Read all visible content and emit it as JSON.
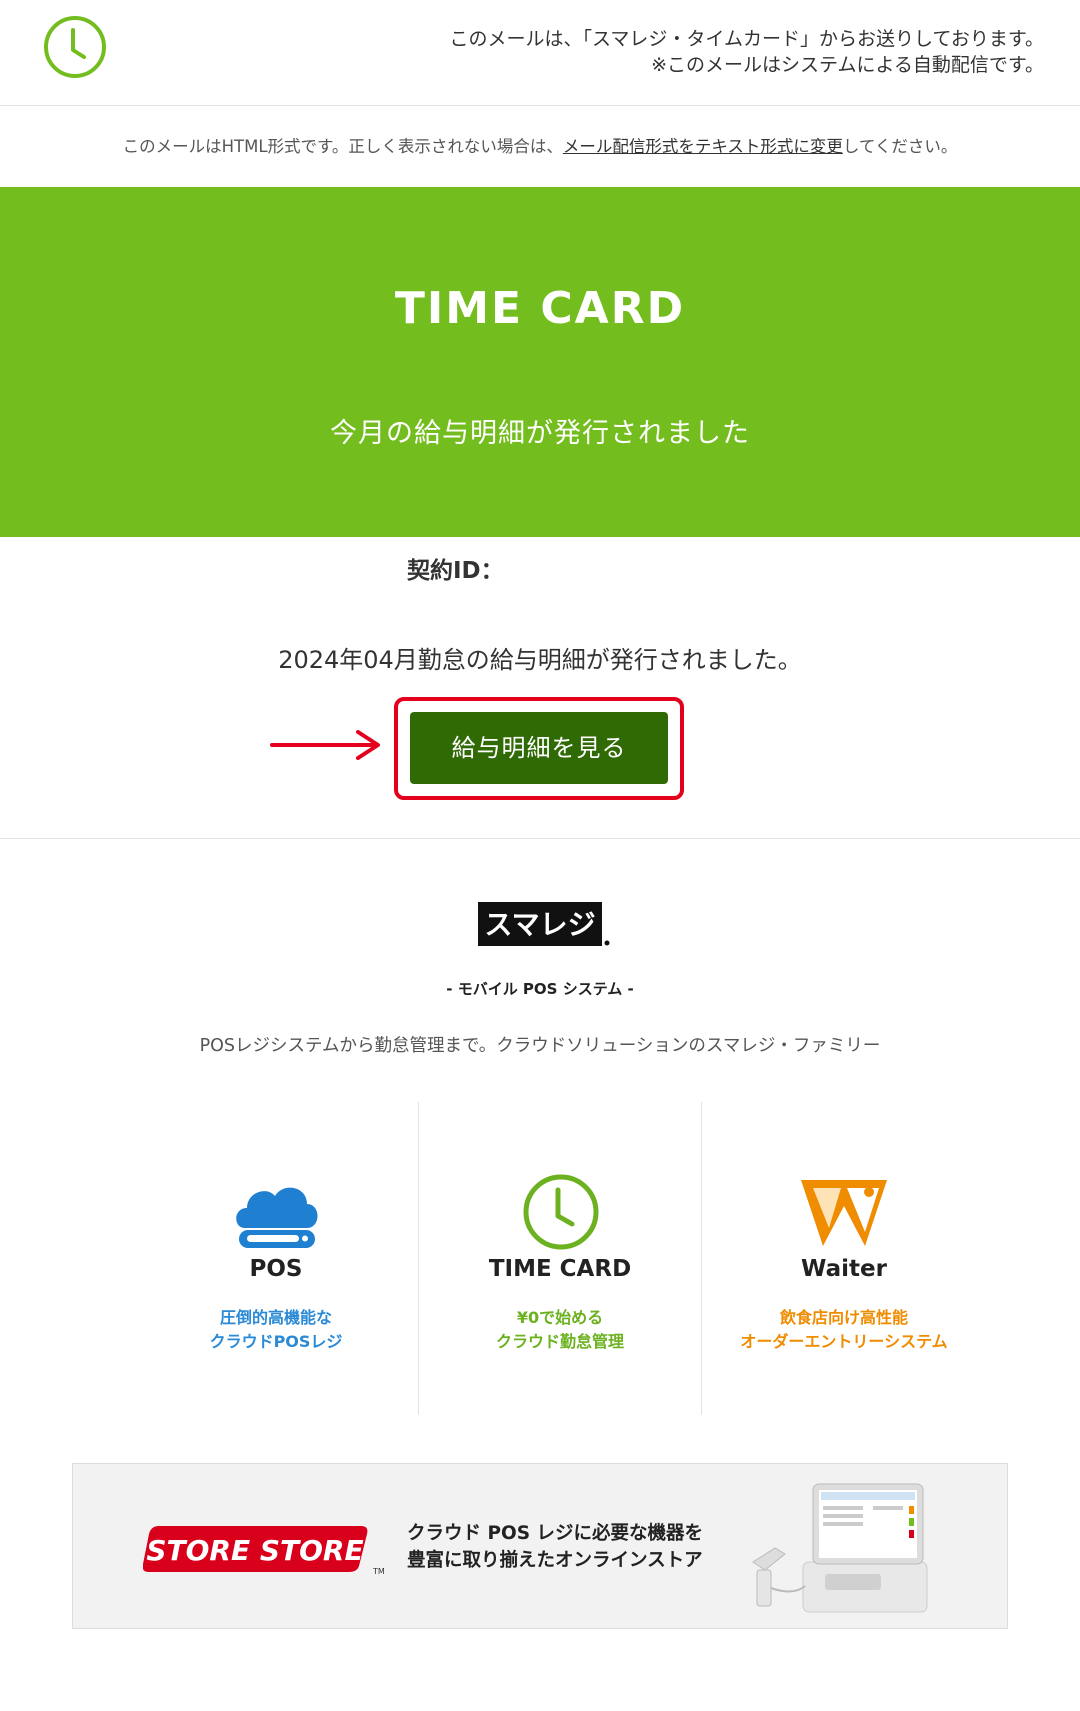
{
  "header": {
    "line1": "このメールは、「スマレジ・タイムカード」からお送りしております。",
    "line2": "※このメールはシステムによる自動配信です。"
  },
  "notice": {
    "prefix": "このメールはHTML形式です。正しく表示されない場合は、",
    "link": "メール配信形式をテキスト形式に変更",
    "suffix": "してください。"
  },
  "hero": {
    "title": "TIME CARD",
    "subtitle": "今月の給与明細が発行されました"
  },
  "contract": {
    "label": "契約ID："
  },
  "message": "2024年04月勤怠の給与明細が発行されました。",
  "view_button": "給与明細を見る",
  "brand": {
    "logo_text": "スマレジ",
    "tagline": "- モバイル POS システム -",
    "family_text": "POSレジシステムから勤怠管理まで。クラウドソリューションのスマレジ・ファミリー"
  },
  "products": [
    {
      "name": "POS",
      "desc1": "圧倒的高機能な",
      "desc2": "クラウドPOSレジ"
    },
    {
      "name": "TIME CARD",
      "desc1": "¥0で始める",
      "desc2": "クラウド勤怠管理"
    },
    {
      "name": "Waiter",
      "desc1": "飲食店向け高性能",
      "desc2": "オーダーエントリーシステム"
    }
  ],
  "banner": {
    "logo_text": "STORE STORE",
    "tm": "TM",
    "line1": "クラウド POS レジに必要な機器を",
    "line2": "豊富に取り揃えたオンラインストア"
  },
  "colors": {
    "brand_green": "#74bd1f",
    "button_green": "#2f6a05",
    "highlight_red": "#e4001c",
    "pos_blue": "#2a8ad6",
    "waiter_orange": "#f08c00"
  }
}
